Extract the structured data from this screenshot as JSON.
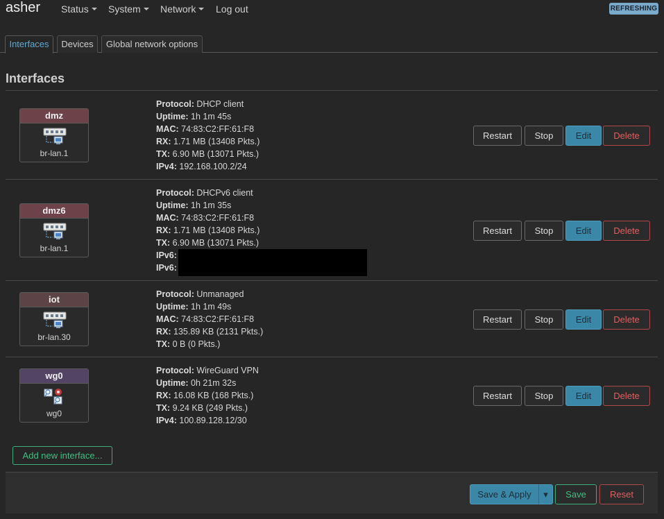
{
  "app": {
    "title": "asher",
    "status_badge": "REFRESHING"
  },
  "menu": [
    {
      "label": "Status",
      "has_dropdown": true
    },
    {
      "label": "System",
      "has_dropdown": true
    },
    {
      "label": "Network",
      "has_dropdown": true
    },
    {
      "label": "Log out",
      "has_dropdown": false
    }
  ],
  "tabs": [
    {
      "label": "Interfaces",
      "active": true
    },
    {
      "label": "Devices",
      "active": false
    },
    {
      "label": "Global network options",
      "active": false
    }
  ],
  "section_title": "Interfaces",
  "interfaces": [
    {
      "name": "dmz",
      "device": "br-lan.1",
      "icon": "ethernet-bridge-icon",
      "details": [
        {
          "key": "Protocol:",
          "value": "DHCP client"
        },
        {
          "key": "Uptime:",
          "value": "1h 1m 45s"
        },
        {
          "key": "MAC:",
          "value": "74:83:C2:FF:61:F8"
        },
        {
          "key": "RX:",
          "value": "1.71 MB (13408 Pkts.)"
        },
        {
          "key": "TX:",
          "value": "6.90 MB (13071 Pkts.)"
        },
        {
          "key": "IPv4:",
          "value": "192.168.100.2/24"
        }
      ]
    },
    {
      "name": "dmz6",
      "device": "br-lan.1",
      "icon": "ethernet-bridge-icon",
      "details": [
        {
          "key": "Protocol:",
          "value": "DHCPv6 client"
        },
        {
          "key": "Uptime:",
          "value": "1h 1m 35s"
        },
        {
          "key": "MAC:",
          "value": "74:83:C2:FF:61:F8"
        },
        {
          "key": "RX:",
          "value": "1.71 MB (13408 Pkts.)"
        },
        {
          "key": "TX:",
          "value": "6.90 MB (13071 Pkts.)"
        },
        {
          "key": "IPv6:",
          "value": ""
        },
        {
          "key": "IPv6:",
          "value": ""
        }
      ]
    },
    {
      "name": "iot",
      "device": "br-lan.30",
      "icon": "ethernet-bridge-icon",
      "details": [
        {
          "key": "Protocol:",
          "value": "Unmanaged"
        },
        {
          "key": "Uptime:",
          "value": "1h 1m 49s"
        },
        {
          "key": "MAC:",
          "value": "74:83:C2:FF:61:F8"
        },
        {
          "key": "RX:",
          "value": "135.89 KB (2131 Pkts.)"
        },
        {
          "key": "TX:",
          "value": "0 B (0 Pkts.)"
        }
      ]
    },
    {
      "name": "wg0",
      "device": "wg0",
      "icon": "tunnel-icon",
      "details": [
        {
          "key": "Protocol:",
          "value": "WireGuard VPN"
        },
        {
          "key": "Uptime:",
          "value": "0h 21m 32s"
        },
        {
          "key": "RX:",
          "value": "16.08 KB (168 Pkts.)"
        },
        {
          "key": "TX:",
          "value": "9.24 KB (249 Pkts.)"
        },
        {
          "key": "IPv4:",
          "value": "100.89.128.12/30"
        }
      ]
    }
  ],
  "row_actions": {
    "restart": "Restart",
    "stop": "Stop",
    "edit": "Edit",
    "delete": "Delete"
  },
  "add_interface_label": "Add new interface...",
  "footer": {
    "save_apply": "Save & Apply",
    "dropdown_glyph": "▾",
    "save": "Save",
    "reset": "Reset"
  },
  "colors": {
    "accent": "#3a87a8",
    "positive": "#3fbf82",
    "negative": "#e06060",
    "badge": "#7aa9c9"
  }
}
